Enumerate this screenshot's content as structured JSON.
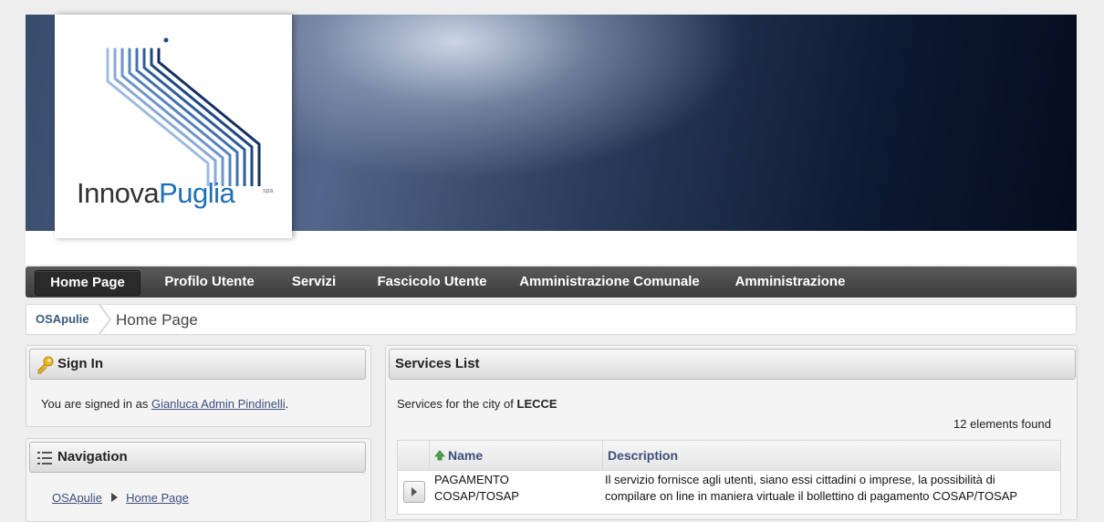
{
  "logo": {
    "brand_left": "Innova",
    "brand_right": "Puglia",
    "brand_suffix": "spa"
  },
  "nav": {
    "items": [
      {
        "label": "Home Page"
      },
      {
        "label": "Profilo Utente"
      },
      {
        "label": "Servizi"
      },
      {
        "label": "Fascicolo Utente"
      },
      {
        "label": "Amministrazione Comunale"
      },
      {
        "label": "Amministrazione"
      }
    ]
  },
  "breadcrumb": {
    "root": "OSApulie",
    "current": "Home Page"
  },
  "signin": {
    "title": "Sign In",
    "text_prefix": "You are signed in as ",
    "user": "Gianluca Admin Pindinelli",
    "text_suffix": "."
  },
  "navigation": {
    "title": "Navigation",
    "path_root": "OSApulie",
    "path_current": "Home Page"
  },
  "services": {
    "title": "Services List",
    "city_prefix": "Services for the city of ",
    "city": "LECCE",
    "count_text": "12 elements found",
    "columns": {
      "name": "Name",
      "description": "Description"
    },
    "rows": [
      {
        "name_line1": "PAGAMENTO",
        "name_line2": "COSAP/TOSAP",
        "desc_line1": "Il servizio fornisce agli utenti, siano essi cittadini o imprese, la possibilità di",
        "desc_line2": "compilare on line in maniera virtuale il bollettino di pagamento COSAP/TOSAP"
      }
    ]
  },
  "colors": {
    "nav_bg": "#4a4a4a",
    "link": "#3c4f7c",
    "accent": "#1f6fb3"
  }
}
